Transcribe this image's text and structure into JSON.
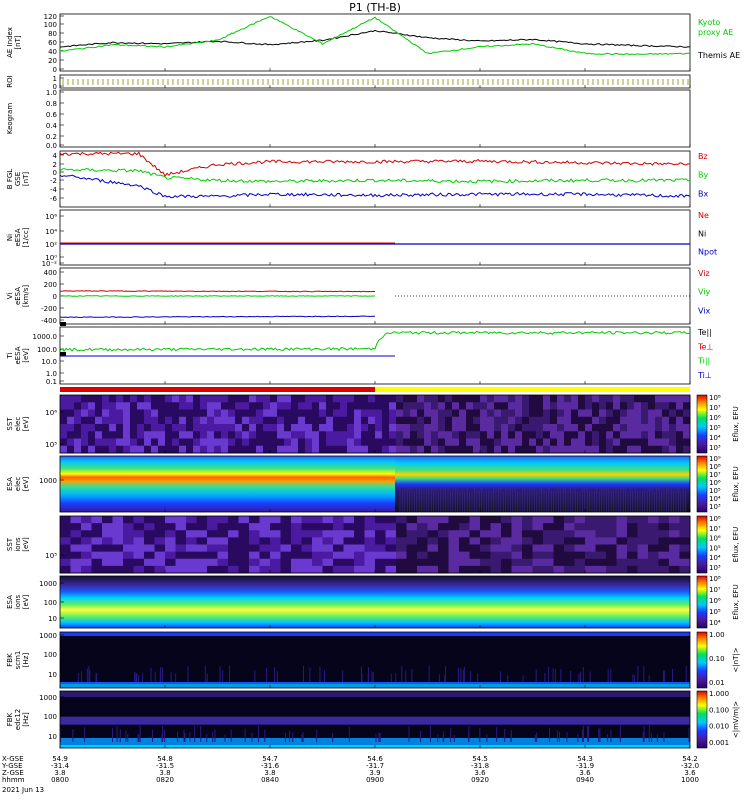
{
  "title": "P1  (TH-B)",
  "date_label": "2021 Jun 13",
  "colors": {
    "black": "#000000",
    "red": "#d00000",
    "green": "#00cc00",
    "blue": "#0000c8",
    "yellow": "#ffff00",
    "roi_mark": "#8a8a00"
  },
  "panels": [
    {
      "id": "ae",
      "ylabel": [
        "AE Index",
        "[nT]"
      ],
      "ticks": [
        "120",
        "100",
        "80",
        "60",
        "40",
        "20",
        "0"
      ],
      "legend": [
        {
          "text": "Kyoto",
          "color": "#00cc00"
        },
        {
          "text": "proxy AE",
          "color": "#00cc00"
        },
        {
          "text": "Themis AE",
          "color": "#000000"
        }
      ]
    },
    {
      "id": "roi",
      "ylabel": [
        "ROI"
      ],
      "ticks": [
        "1",
        "0"
      ],
      "legend": []
    },
    {
      "id": "keogram",
      "ylabel": [
        "Keogram"
      ],
      "ticks": [
        "1.0",
        "0.8",
        "0.6",
        "0.4",
        "0.2",
        "0.0"
      ],
      "legend": []
    },
    {
      "id": "bfgl",
      "ylabel": [
        "B FGL",
        "GSE",
        "[nT]"
      ],
      "ticks": [
        "4",
        "2",
        "0",
        "-2",
        "-4",
        "-6"
      ],
      "legend": [
        {
          "text": "Bz",
          "color": "#d00000"
        },
        {
          "text": "By",
          "color": "#00cc00"
        },
        {
          "text": "Bx",
          "color": "#0000c8"
        }
      ]
    },
    {
      "id": "ni",
      "ylabel": [
        "Ni",
        "eESA",
        "[1/cc]"
      ],
      "ticks": [
        "10⁶",
        "10⁴",
        "10²",
        "10⁰",
        "10⁻²"
      ],
      "legend": [
        {
          "text": "Ne",
          "color": "#d00000"
        },
        {
          "text": "Ni",
          "color": "#000000"
        },
        {
          "text": "Npot",
          "color": "#0000c8"
        }
      ]
    },
    {
      "id": "vi",
      "ylabel": [
        "Vi",
        "eESA",
        "[km/s]"
      ],
      "ticks": [
        "400",
        "200",
        "0",
        "-200",
        "-400"
      ],
      "legend": [
        {
          "text": "Viz",
          "color": "#d00000"
        },
        {
          "text": "Viy",
          "color": "#00cc00"
        },
        {
          "text": "Vix",
          "color": "#0000c8"
        }
      ]
    },
    {
      "id": "ti",
      "ylabel": [
        "Ti",
        "eESA",
        "[eV]"
      ],
      "ticks": [
        "1000.0",
        "100.0",
        "10.0",
        "1.0",
        "0.1"
      ],
      "legend": [
        {
          "text": "Te||",
          "color": "#000000"
        },
        {
          "text": "Te⊥",
          "color": "#d00000"
        },
        {
          "text": "Ti||",
          "color": "#00cc00"
        },
        {
          "text": "Ti⊥",
          "color": "#0000c8"
        }
      ]
    },
    {
      "id": "sst_e",
      "ylabel": [
        "SST",
        "elec",
        "[eV]"
      ],
      "ticks": [
        "10⁶",
        "10⁵"
      ],
      "cbar_label": "Eflux, EFU",
      "cbar_ticks": [
        "10⁸",
        "10⁷",
        "10⁶",
        "10⁵",
        "10⁴",
        "10³"
      ]
    },
    {
      "id": "esa_e",
      "ylabel": [
        "ESA",
        "elec",
        "[eV]"
      ],
      "ticks": [
        "1000"
      ],
      "cbar_label": "Eflux, EFU",
      "cbar_ticks": [
        "10⁹",
        "10⁸",
        "10⁷",
        "10⁶",
        "10⁵",
        "10⁴",
        "10³"
      ]
    },
    {
      "id": "sst_i",
      "ylabel": [
        "SST",
        "ions",
        "[eV]"
      ],
      "ticks": [
        "10⁵"
      ],
      "cbar_label": "Eflux, EFU",
      "cbar_ticks": [
        "10⁸",
        "10⁷",
        "10⁶",
        "10⁵",
        "10⁴",
        "10³"
      ]
    },
    {
      "id": "esa_i",
      "ylabel": [
        "ESA",
        "ions",
        "[eV]"
      ],
      "ticks": [
        "1000",
        "100",
        "10"
      ],
      "cbar_label": "Eflux, EFU",
      "cbar_ticks": [
        "10⁸",
        "10⁷",
        "10⁶",
        "10⁵",
        "10⁴"
      ]
    },
    {
      "id": "fbk_scm",
      "ylabel": [
        "FBK",
        "scm1",
        "[Hz]"
      ],
      "ticks": [
        "1000",
        "100",
        "10"
      ],
      "cbar_label": "<|nT|>",
      "cbar_ticks": [
        "1.00",
        "0.10",
        "0.01"
      ]
    },
    {
      "id": "fbk_efi",
      "ylabel": [
        "FBK",
        "edc12",
        "[Hz]"
      ],
      "ticks": [
        "1000",
        "100",
        "10"
      ],
      "cbar_label": "<|mV/m|>",
      "cbar_ticks": [
        "1.000",
        "0.100",
        "0.010",
        "0.001"
      ]
    }
  ],
  "xaxis": {
    "row_labels": [
      "X-GSE",
      "Y-GSE",
      "Z-GSE",
      "hhmm"
    ],
    "columns": [
      {
        "x": "54.9",
        "y": "-31.4",
        "z": "3.8",
        "hhmm": "0800"
      },
      {
        "x": "54.8",
        "y": "-31.5",
        "z": "3.8",
        "hhmm": "0820"
      },
      {
        "x": "54.7",
        "y": "-31.6",
        "z": "3.8",
        "hhmm": "0840"
      },
      {
        "x": "54.6",
        "y": "-31.7",
        "z": "3.9",
        "hhmm": "0900"
      },
      {
        "x": "54.5",
        "y": "-31.8",
        "z": "3.6",
        "hhmm": "0920"
      },
      {
        "x": "54.3",
        "y": "-31.9",
        "z": "3.6",
        "hhmm": "0940"
      },
      {
        "x": "54.2",
        "y": "-32.0",
        "z": "3.6",
        "hhmm": "1000"
      }
    ]
  },
  "chart_data": {
    "type": "line",
    "title": "P1  (TH-B)",
    "time_range": [
      "0800",
      "1000"
    ],
    "time_ticks": [
      "0800",
      "0820",
      "0840",
      "0900",
      "0920",
      "0940",
      "1000"
    ],
    "series": [
      {
        "panel": "ae",
        "name": "Themis AE",
        "unit": "nT",
        "x": [
          "0800",
          "0810",
          "0820",
          "0830",
          "0840",
          "0850",
          "0900",
          "0910",
          "0920",
          "0930",
          "0940",
          "0950",
          "1000"
        ],
        "values": [
          55,
          65,
          62,
          68,
          60,
          70,
          92,
          76,
          68,
          72,
          62,
          58,
          55
        ]
      },
      {
        "panel": "ae",
        "name": "Kyoto proxy AE",
        "unit": "nT",
        "x": [
          "0800",
          "0810",
          "0820",
          "0830",
          "0840",
          "0850",
          "0900",
          "0910",
          "0920",
          "0930",
          "0940",
          "0950",
          "1000"
        ],
        "values": [
          45,
          60,
          55,
          70,
          125,
          62,
          122,
          40,
          55,
          62,
          40,
          38,
          40
        ]
      },
      {
        "panel": "bfgl",
        "name": "Bz",
        "unit": "nT",
        "x": [
          "0800",
          "0815",
          "0820",
          "0830",
          "0840",
          "0900",
          "0920",
          "0940",
          "1000"
        ],
        "values": [
          4.0,
          4.0,
          0.0,
          2.0,
          2.5,
          2.5,
          2.6,
          2.3,
          2.0
        ]
      },
      {
        "panel": "bfgl",
        "name": "By",
        "unit": "nT",
        "x": [
          "0800",
          "0815",
          "0820",
          "0830",
          "0840",
          "0900",
          "0920",
          "0940",
          "1000"
        ],
        "values": [
          1.0,
          0.8,
          -0.5,
          -1.0,
          -1.2,
          -1.0,
          -1.2,
          -1.0,
          -1.0
        ]
      },
      {
        "panel": "bfgl",
        "name": "Bx",
        "unit": "nT",
        "x": [
          "0800",
          "0815",
          "0820",
          "0830",
          "0840",
          "0900",
          "0920",
          "0940",
          "1000"
        ],
        "values": [
          0.0,
          -2.0,
          -4.0,
          -4.0,
          -3.6,
          -3.8,
          -3.6,
          -3.6,
          -4.0
        ]
      },
      {
        "panel": "vi",
        "name": "Viz",
        "unit": "km/s",
        "x": [
          "0800",
          "0900"
        ],
        "values": [
          90,
          80
        ]
      },
      {
        "panel": "vi",
        "name": "Viy",
        "unit": "km/s",
        "x": [
          "0800",
          "0900"
        ],
        "values": [
          0,
          0
        ]
      },
      {
        "panel": "vi",
        "name": "Vix",
        "unit": "km/s",
        "x": [
          "0800",
          "0900"
        ],
        "values": [
          -380,
          -360
        ]
      },
      {
        "panel": "ti",
        "name": "Ti||",
        "unit": "eV",
        "x": [
          "0800",
          "0900",
          "0903",
          "1000"
        ],
        "values": [
          30,
          35,
          700,
          700
        ]
      }
    ],
    "mode_bar": {
      "red": [
        "0800",
        "0900"
      ],
      "yellow": [
        "0900",
        "1000"
      ]
    }
  }
}
